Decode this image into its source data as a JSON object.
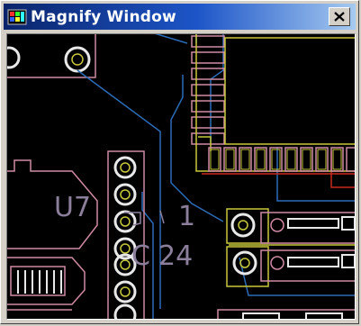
{
  "window": {
    "title": "Magnify Window",
    "close_label": "✕",
    "icon": "magnify-app-icon",
    "close_icon": "close-icon"
  },
  "canvas": {
    "background": "#000000",
    "labels": [
      "U7",
      "1",
      "C",
      "24"
    ]
  },
  "colors": {
    "titlebar_start": "#0a246a",
    "titlebar_end": "#a6caf0",
    "trace_blue": "#2b6cb8",
    "trace_red": "#c8281e",
    "outline_pink": "#d08aa6",
    "outline_yellow": "#c8c83c",
    "silkscreen": "#8c7f9c",
    "pad_white": "#e8e8e8"
  }
}
